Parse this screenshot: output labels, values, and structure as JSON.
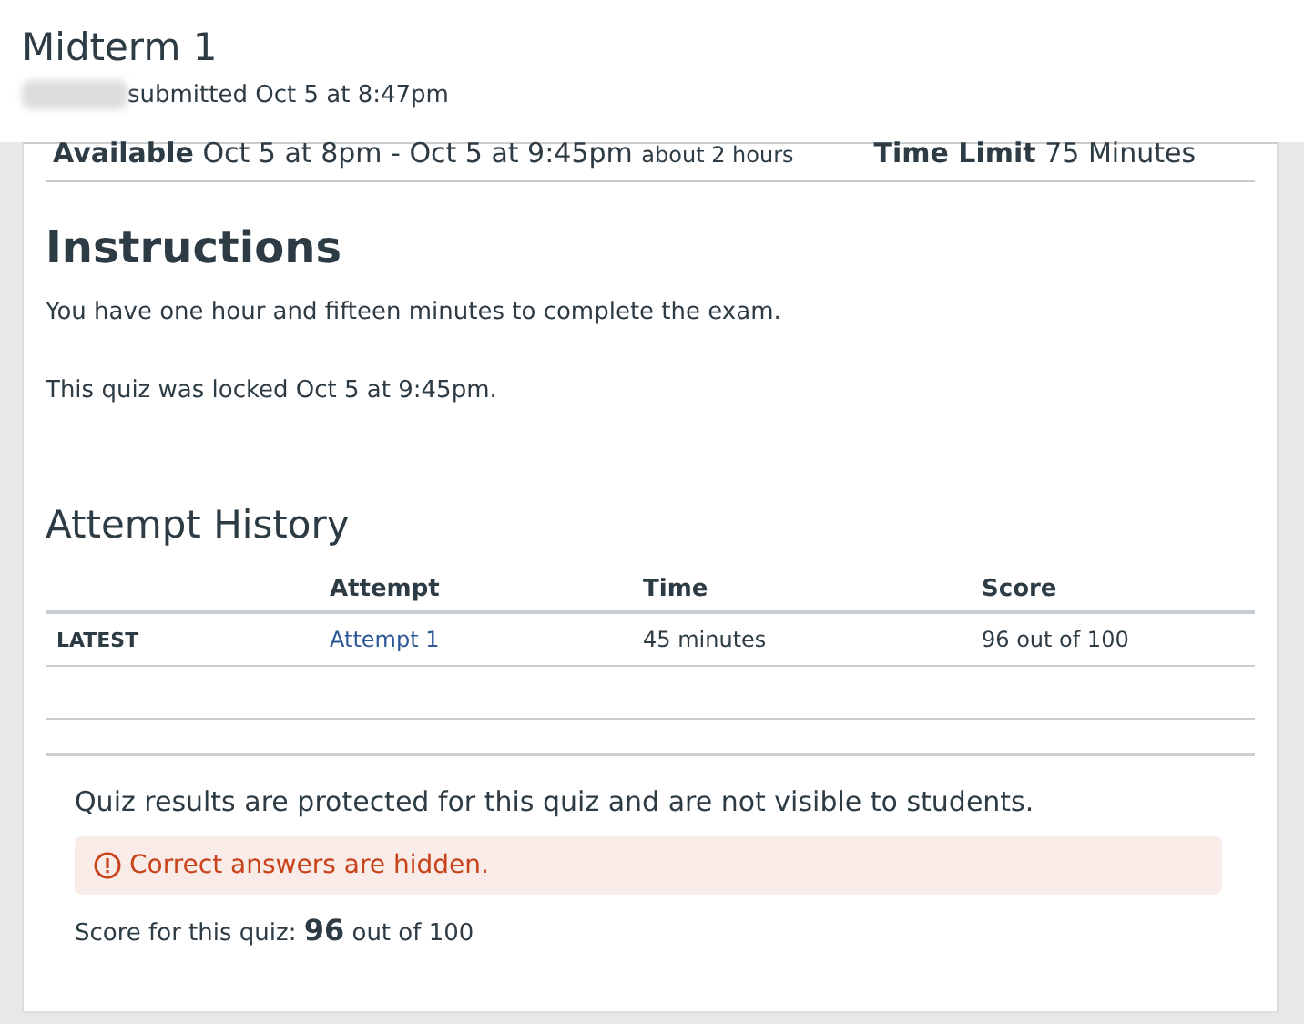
{
  "header": {
    "title": "Midterm 1",
    "submitted": "submitted Oct 5 at 8:47pm"
  },
  "details": [
    {
      "label": "Available",
      "value": "Oct 5 at 8pm - Oct 5 at 9:45pm",
      "note": "about 2 hours"
    },
    {
      "label": "Time Limit",
      "value": "75 Minutes"
    }
  ],
  "instructions": {
    "heading": "Instructions",
    "paragraphs": [
      "You have one hour and fifteen minutes to complete the exam.",
      "This quiz was locked Oct 5 at 9:45pm."
    ]
  },
  "attempt_history": {
    "heading": "Attempt History",
    "columns": [
      "",
      "Attempt",
      "Time",
      "Score"
    ],
    "rows": [
      {
        "label": "LATEST",
        "attempt": "Attempt 1",
        "time": "45 minutes",
        "score": "96 out of 100"
      }
    ]
  },
  "results": {
    "message": "Quiz results are protected for this quiz and are not visible to students.",
    "alert": "Correct answers are hidden.",
    "score": "Score for this quiz: **96** out of 100"
  }
}
